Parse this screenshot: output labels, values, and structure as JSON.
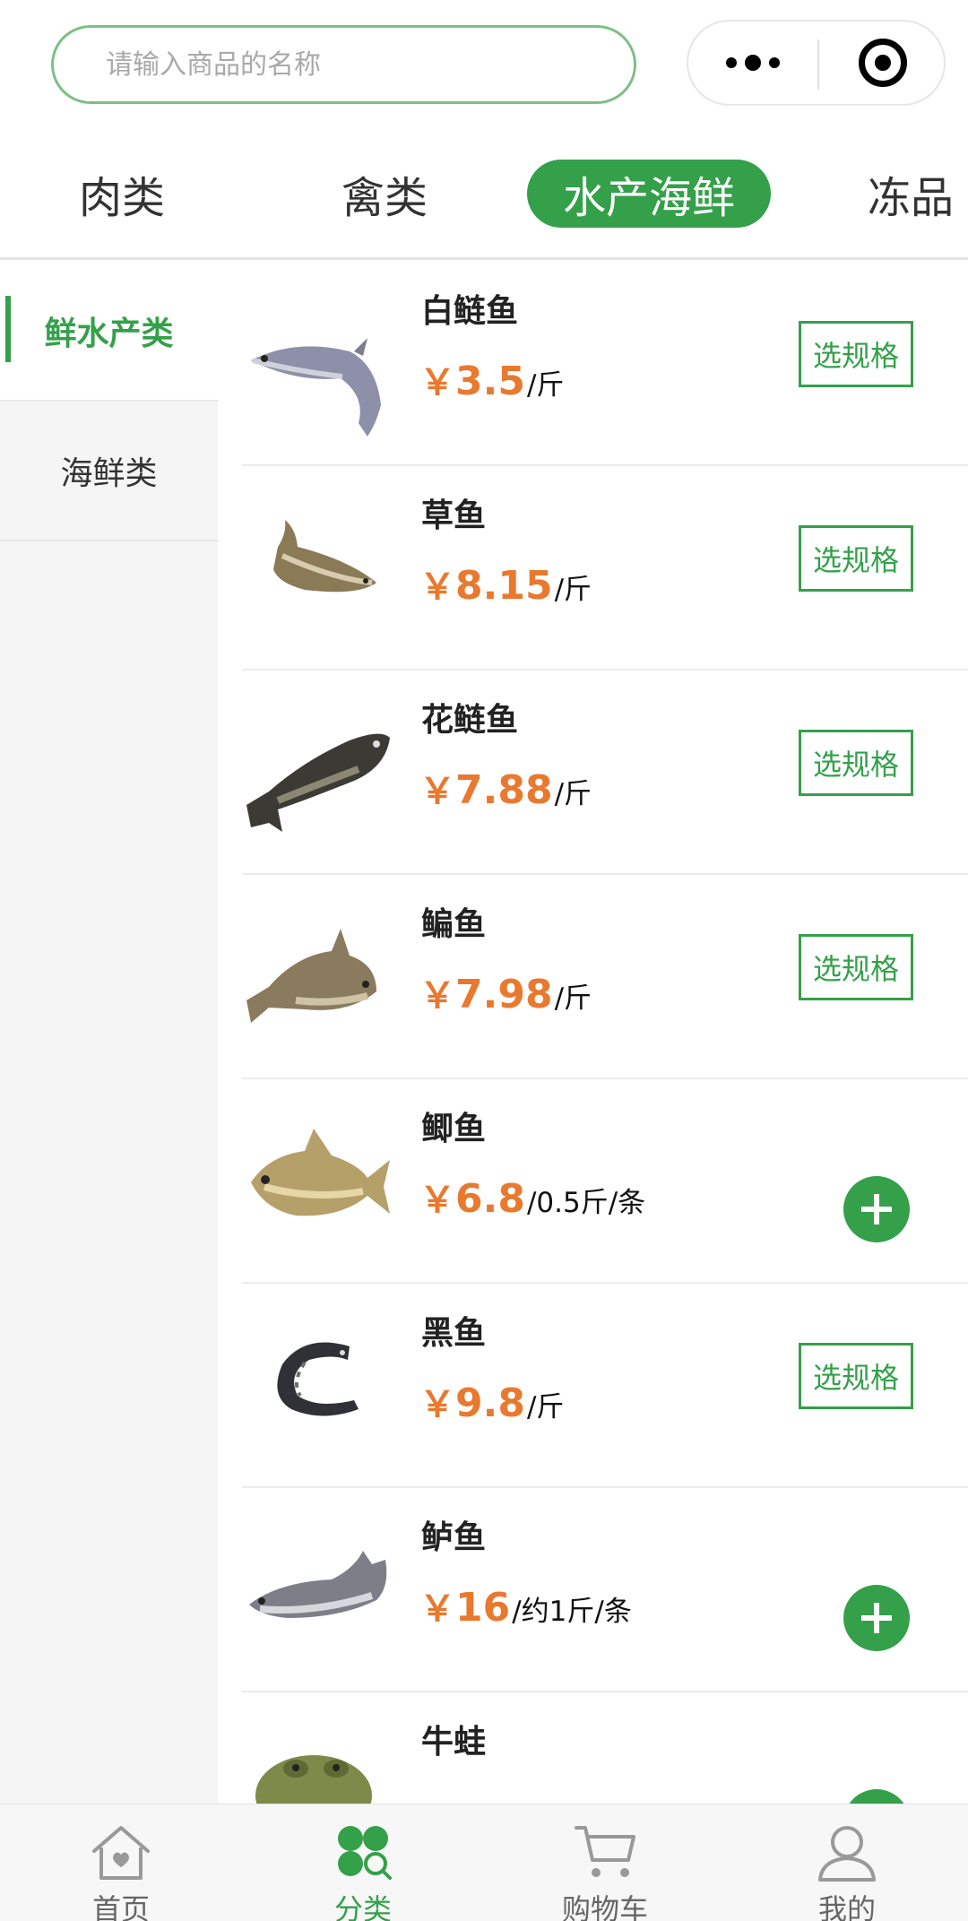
{
  "search": {
    "placeholder": "请输入商品的名称"
  },
  "capsule": {
    "more_icon": "more-dots-icon",
    "close_icon": "record-target-icon"
  },
  "tabs": [
    {
      "label": "肉类",
      "active": false
    },
    {
      "label": "禽类",
      "active": false
    },
    {
      "label": "水产海鲜",
      "active": true
    },
    {
      "label": "冻品",
      "active": false
    }
  ],
  "sidebar": {
    "items": [
      {
        "label": "鲜水产类",
        "active": true
      },
      {
        "label": "海鲜类",
        "active": false
      }
    ]
  },
  "products": [
    {
      "name": "白鲢鱼",
      "currency": "￥",
      "price": "3.5",
      "unit": "/斤",
      "action": "spec",
      "action_label": "选规格"
    },
    {
      "name": "草鱼",
      "currency": "￥",
      "price": "8.15",
      "unit": "/斤",
      "action": "spec",
      "action_label": "选规格"
    },
    {
      "name": "花鲢鱼",
      "currency": "￥",
      "price": "7.88",
      "unit": "/斤",
      "action": "spec",
      "action_label": "选规格"
    },
    {
      "name": "鳊鱼",
      "currency": "￥",
      "price": "7.98",
      "unit": "/斤",
      "action": "spec",
      "action_label": "选规格"
    },
    {
      "name": "鲫鱼",
      "currency": "￥",
      "price": "6.8",
      "unit": "/0.5斤/条",
      "action": "add",
      "action_label": ""
    },
    {
      "name": "黑鱼",
      "currency": "￥",
      "price": "9.8",
      "unit": "/斤",
      "action": "spec",
      "action_label": "选规格"
    },
    {
      "name": "鲈鱼",
      "currency": "￥",
      "price": "16",
      "unit": "/约1斤/条",
      "action": "add",
      "action_label": ""
    },
    {
      "name": "牛蛙",
      "currency": "",
      "price": "",
      "unit": "",
      "action": "add",
      "action_label": ""
    }
  ],
  "tabbar": {
    "items": [
      {
        "label": "首页",
        "icon": "home-icon",
        "active": false
      },
      {
        "label": "分类",
        "icon": "category-icon",
        "active": true
      },
      {
        "label": "购物车",
        "icon": "cart-icon",
        "active": false
      },
      {
        "label": "我的",
        "icon": "user-icon",
        "active": false
      }
    ]
  },
  "colors": {
    "accent": "#34a04a",
    "price": "#e8792e",
    "search_border": "#7cbf87"
  }
}
